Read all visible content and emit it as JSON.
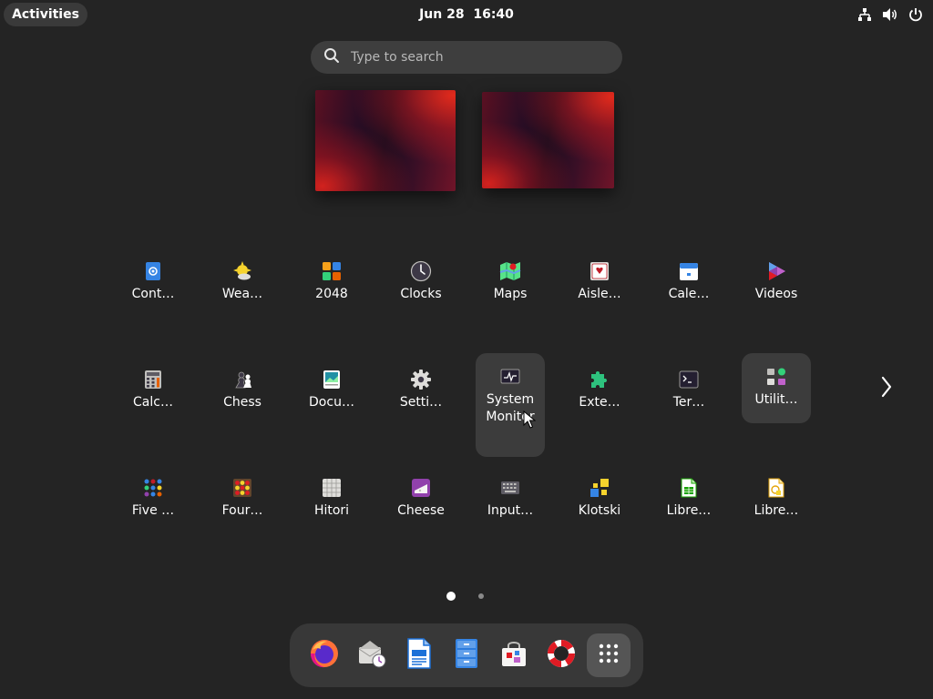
{
  "topbar": {
    "activities_label": "Activities",
    "datetime": "Jun 28  16:40",
    "tray_icons": [
      "network-icon",
      "volume-icon",
      "power-icon"
    ]
  },
  "search": {
    "placeholder": "Type to search"
  },
  "apps": {
    "row1": [
      "Cont…",
      "Wea…",
      "2048",
      "Clocks",
      "Maps",
      "Aisle…",
      "Cale…",
      "Videos"
    ],
    "row2": [
      "Calc…",
      "Chess",
      "Docu…",
      "Setti…",
      "System Monitor",
      "Exte…",
      "Ter…",
      "Utilit…"
    ],
    "row3": [
      "Five …",
      "Four…",
      "Hitori",
      "Cheese",
      "Input…",
      "Klotski",
      "Libre…",
      "Libre…"
    ]
  },
  "pagination": {
    "current_page": 1,
    "total_pages": 2
  },
  "dash": {
    "items": [
      "firefox-icon",
      "evolution-mail-icon",
      "libreoffice-writer-icon",
      "files-icon",
      "software-store-icon",
      "help-icon",
      "show-apps-icon"
    ]
  },
  "colors": {
    "background": "#242424",
    "panel": "#3a3a3a",
    "selection": "#3c3c3c",
    "accent": "#3584e4"
  }
}
